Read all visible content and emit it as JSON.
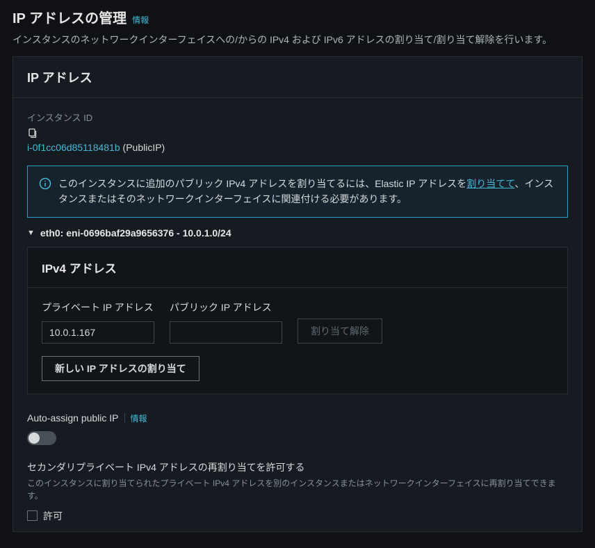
{
  "header": {
    "title": "IP アドレスの管理",
    "info_label": "情報",
    "description": "インスタンスのネットワークインターフェイスへの/からの IPv4 および IPv6 アドレスの割り当て/割り当て解除を行います。"
  },
  "panel": {
    "title": "IP アドレス",
    "instance_id_label": "インスタンス ID",
    "instance_id": "i-0f1cc06d85118481b",
    "instance_name": "(PublicIP)",
    "alert": {
      "text_prefix": "このインスタンスに追加のパブリック IPv4 アドレスを割り当てるには、Elastic IP アドレスを",
      "link": "割り当てて",
      "text_suffix": "、インスタンスまたはそのネットワークインターフェイスに関連付ける必要があります。"
    },
    "eni": {
      "label": "eth0: eni-0696baf29a9656376 - 10.0.1.0/24"
    },
    "ipv4": {
      "title": "IPv4 アドレス",
      "private_label": "プライベート IP アドレス",
      "public_label": "パブリック IP アドレス",
      "private_value": "10.0.1.167",
      "public_value": "",
      "unassign_button": "割り当て解除",
      "assign_button": "新しい IP アドレスの割り当て"
    }
  },
  "auto_assign": {
    "label": "Auto-assign public IP",
    "info_label": "情報"
  },
  "secondary": {
    "title": "セカンダリプライベート IPv4 アドレスの再割り当てを許可する",
    "description": "このインスタンスに割り当てられたプライベート IPv4 アドレスを別のインスタンスまたはネットワークインターフェイスに再割り当てできます。",
    "checkbox_label": "許可"
  }
}
